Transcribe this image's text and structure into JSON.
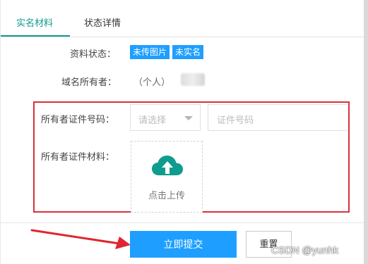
{
  "tabs": [
    {
      "label": "实名材料",
      "active": true
    },
    {
      "label": "状态详情",
      "active": false
    }
  ],
  "status": {
    "label": "资料状态：",
    "badges": [
      "未传图片",
      "未实名"
    ]
  },
  "owner": {
    "label": "域名所有者：",
    "value": "（个人）"
  },
  "id_number": {
    "label": "所有者证件号码：",
    "select_placeholder": "请选择",
    "input_placeholder": "证件号码"
  },
  "id_material": {
    "label": "所有者证件材料：",
    "upload_text": "点击上传"
  },
  "actions": {
    "submit": "立即提交",
    "reset": "重置"
  },
  "watermark": "CSDN @yunhk",
  "colors": {
    "accent_tab": "#0e9c8e",
    "primary_button": "#1e9fff",
    "highlight_box": "#d8323c",
    "upload_icon": "#0e9c8e"
  }
}
